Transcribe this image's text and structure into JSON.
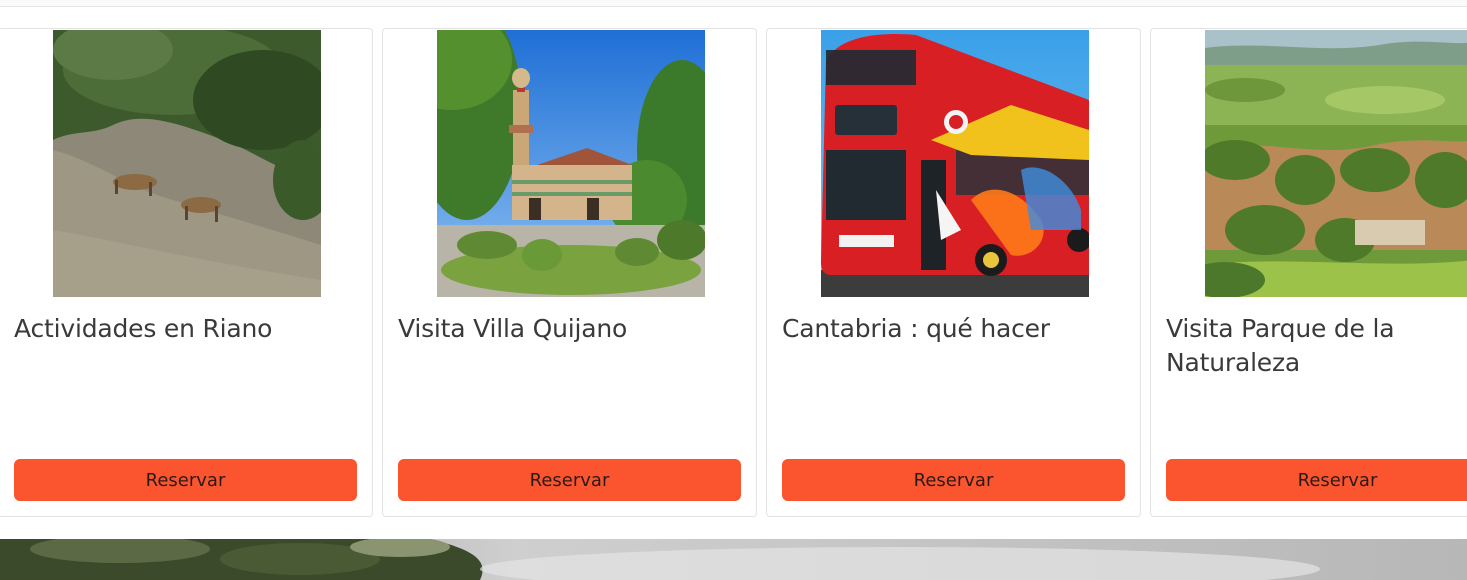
{
  "cards": [
    {
      "title": "Actividades en Riano",
      "button_label": "Reservar",
      "image": "wolves-on-hillside-photo"
    },
    {
      "title": "Visita Villa Quijano",
      "button_label": "Reservar",
      "image": "el-capricho-villa-photo"
    },
    {
      "title": "Cantabria : qué hacer",
      "button_label": "Reservar",
      "image": "red-double-decker-bus-photo"
    },
    {
      "title": "Visita Parque de la Naturaleza",
      "button_label": "Reservar",
      "image": "cabarceno-park-aerial-photo"
    }
  ],
  "colors": {
    "button": "#fb5530",
    "title_text": "#3a3a3a",
    "card_border": "#e3e3e3"
  }
}
